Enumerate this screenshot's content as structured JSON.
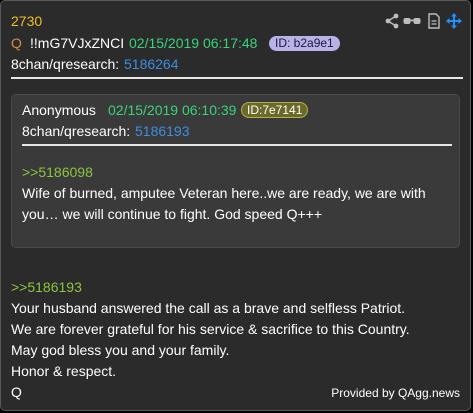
{
  "post": {
    "number": "2730",
    "q_marker": "Q",
    "tripcode": "!!mG7VJxZNCI",
    "datetime": "02/15/2019 06:17:48",
    "id": "ID: b2a9e1",
    "board": "8chan/qresearch:",
    "post_id": "5186264"
  },
  "quoted": {
    "author": "Anonymous",
    "datetime": "02/15/2019 06:10:39",
    "id": "ID:7e7141",
    "board": "8chan/qresearch:",
    "post_id": "5186193",
    "reply_ref": ">>5186098",
    "body_line1": "Wife of burned, amputee Veteran here..we are ready, we are with",
    "body_line2": "you… we will continue to fight. God speed Q+++"
  },
  "message": {
    "reply_ref": ">>5186193",
    "line1": "Your husband answered the call as a brave and selfless Patriot.",
    "line2": "We are forever grateful for his service & sacrifice to this Country.",
    "line3": "May god bless you and your family.",
    "line4": "Honor & respect.",
    "line5": "Q"
  },
  "footer": {
    "text": "Provided by QAgg.news"
  },
  "icons": [
    "share-icon",
    "glasses-icon",
    "document-icon",
    "move-icon"
  ],
  "colors": {
    "card_bg": "#2b2b2b",
    "quote_bg": "#3a3a3a",
    "number": "#f0c020",
    "date": "#39d37a",
    "link": "#3f8de0",
    "greentext": "#8cc63f",
    "id_pill": "#b9b2e8",
    "move_icon": "#1e90ff"
  }
}
